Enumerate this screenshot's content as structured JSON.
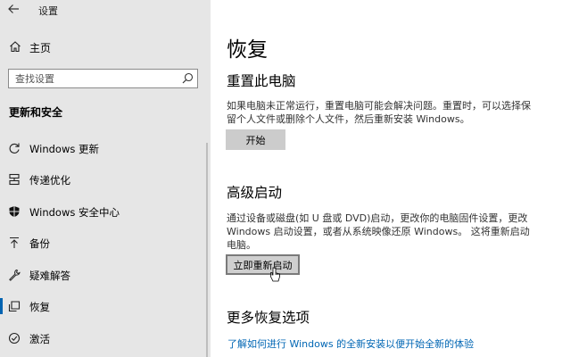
{
  "window": {
    "title": "设置"
  },
  "sidebar": {
    "home_label": "主页",
    "search": {
      "placeholder": "查找设置",
      "value": ""
    },
    "section_title": "更新和安全",
    "items": [
      {
        "label": "Windows 更新",
        "icon": "refresh-icon"
      },
      {
        "label": "传递优化",
        "icon": "delivery-optimization-icon"
      },
      {
        "label": "Windows 安全中心",
        "icon": "shield-icon"
      },
      {
        "label": "备份",
        "icon": "backup-arrow-icon"
      },
      {
        "label": "疑难解答",
        "icon": "wrench-icon"
      },
      {
        "label": "恢复",
        "icon": "recovery-icon",
        "selected": true
      },
      {
        "label": "激活",
        "icon": "activation-check-icon"
      }
    ]
  },
  "main": {
    "title": "恢复",
    "reset": {
      "heading": "重置此电脑",
      "description": "如果电脑未正常运行，重置电脑可能会解决问题。重置时，可以选择保留个人文件或删除个人文件，然后重新安装 Windows。",
      "button": "开始"
    },
    "advanced": {
      "heading": "高级启动",
      "description": "通过设备或磁盘(如 U 盘或 DVD)启动，更改你的电脑固件设置，更改 Windows 启动设置，或者从系统映像还原 Windows。 这将重新启动电脑。",
      "button": "立即重新启动"
    },
    "more": {
      "heading": "更多恢复选项",
      "link": "了解如何进行 Windows 的全新安装以便开始全新的体验"
    }
  },
  "colors": {
    "accent": "#0063b1",
    "sidebar_bg": "#e6e6e6",
    "link": "#0066b4",
    "button_bg": "#cccccc"
  }
}
